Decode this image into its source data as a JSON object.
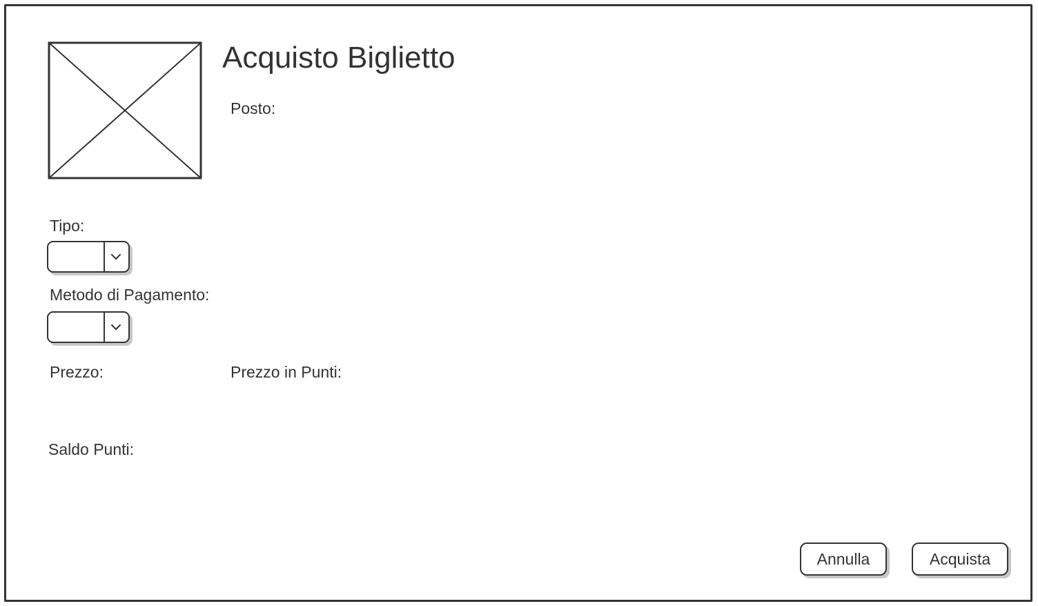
{
  "window": {
    "title": "Acquisto Biglietto"
  },
  "header": {
    "image_icon": "image-placeholder-icon",
    "posto_label": "Posto:"
  },
  "form": {
    "tipo": {
      "label": "Tipo:",
      "selected": ""
    },
    "metodo_pagamento": {
      "label": "Metodo di Pagamento:",
      "selected": ""
    },
    "prezzo_label": "Prezzo:",
    "prezzo_punti_label": "Prezzo in Punti:",
    "saldo_punti_label": "Saldo Punti:"
  },
  "actions": {
    "cancel_label": "Annulla",
    "confirm_label": "Acquista"
  },
  "colors": {
    "stroke": "#333333",
    "shadow": "#c8c8c8",
    "background": "#ffffff"
  }
}
